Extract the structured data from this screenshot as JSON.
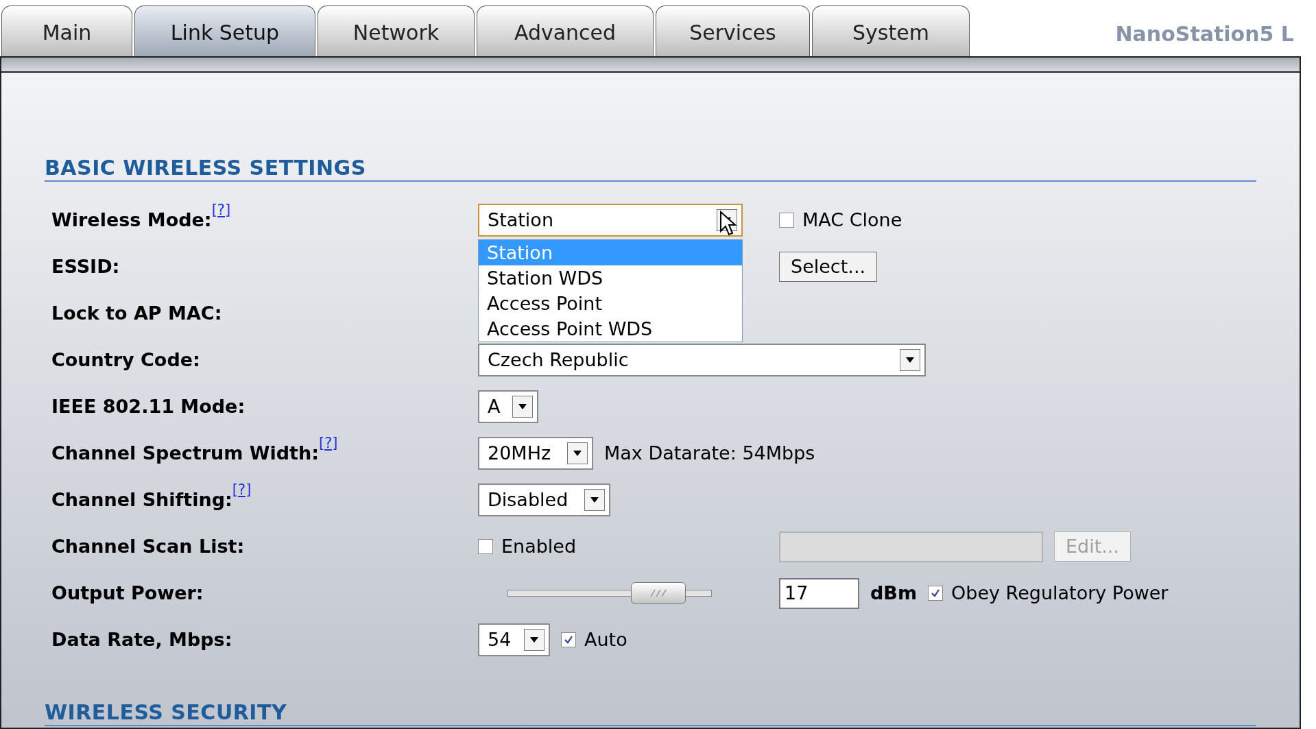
{
  "tabs": [
    {
      "label": "Main",
      "selected": false
    },
    {
      "label": "Link Setup",
      "selected": true
    },
    {
      "label": "Network",
      "selected": false
    },
    {
      "label": "Advanced",
      "selected": false
    },
    {
      "label": "Services",
      "selected": false
    },
    {
      "label": "System",
      "selected": false
    }
  ],
  "device_name": "NanoStation5 L",
  "basic": {
    "title": "BASIC WIRELESS SETTINGS",
    "rows": [
      {
        "label": "Wireless Mode:",
        "help": "[?]",
        "main": [
          {
            "kind": "select",
            "value": "Station",
            "open": true,
            "options": [
              {
                "label": "Station",
                "selected": true
              },
              {
                "label": "Station WDS",
                "selected": false
              },
              {
                "label": "Access Point",
                "selected": false
              },
              {
                "label": "Access Point WDS",
                "selected": false
              }
            ]
          }
        ],
        "side": [
          {
            "kind": "checkbox",
            "label": "MAC Clone",
            "checked": false
          }
        ]
      },
      {
        "label": "ESSID:",
        "main": [],
        "side": [
          {
            "kind": "button",
            "label": "Select...",
            "disabled": false
          }
        ]
      },
      {
        "label": "Lock to AP MAC:",
        "main": [],
        "side": []
      },
      {
        "label": "Country Code:",
        "main": [
          {
            "kind": "select",
            "value": "Czech Republic",
            "open": false
          }
        ],
        "side": []
      },
      {
        "label": "IEEE 802.11 Mode:",
        "main": [
          {
            "kind": "select",
            "value": "A",
            "open": false
          }
        ],
        "side": []
      },
      {
        "label": "Channel Spectrum Width:",
        "help": "[?]",
        "main": [
          {
            "kind": "select",
            "value": "20MHz",
            "open": false
          },
          {
            "kind": "text",
            "text": "Max Datarate: 54Mbps"
          }
        ],
        "side": []
      },
      {
        "label": "Channel Shifting:",
        "help": "[?]",
        "main": [
          {
            "kind": "select",
            "value": "Disabled",
            "open": false
          }
        ],
        "side": []
      },
      {
        "label": "Channel Scan List:",
        "main": [
          {
            "kind": "checkbox",
            "label": "Enabled",
            "checked": false
          }
        ],
        "side": [
          {
            "kind": "field",
            "disabled": true
          },
          {
            "kind": "button",
            "label": "Edit...",
            "disabled": true
          }
        ]
      },
      {
        "label": "Output Power:",
        "main": [
          {
            "kind": "slider",
            "level": 0.74
          }
        ],
        "side": [
          {
            "kind": "field",
            "value": "17",
            "disabled": false
          },
          {
            "kind": "unit",
            "text": "dBm"
          },
          {
            "kind": "checkbox",
            "label": "Obey Regulatory Power",
            "checked": true
          }
        ]
      },
      {
        "label": "Data Rate, Mbps:",
        "main": [
          {
            "kind": "select",
            "value": "54",
            "open": false
          },
          {
            "kind": "checkbox",
            "label": "Auto",
            "checked": true
          }
        ],
        "side": []
      }
    ]
  },
  "security": {
    "title": "WIRELESS SECURITY"
  }
}
